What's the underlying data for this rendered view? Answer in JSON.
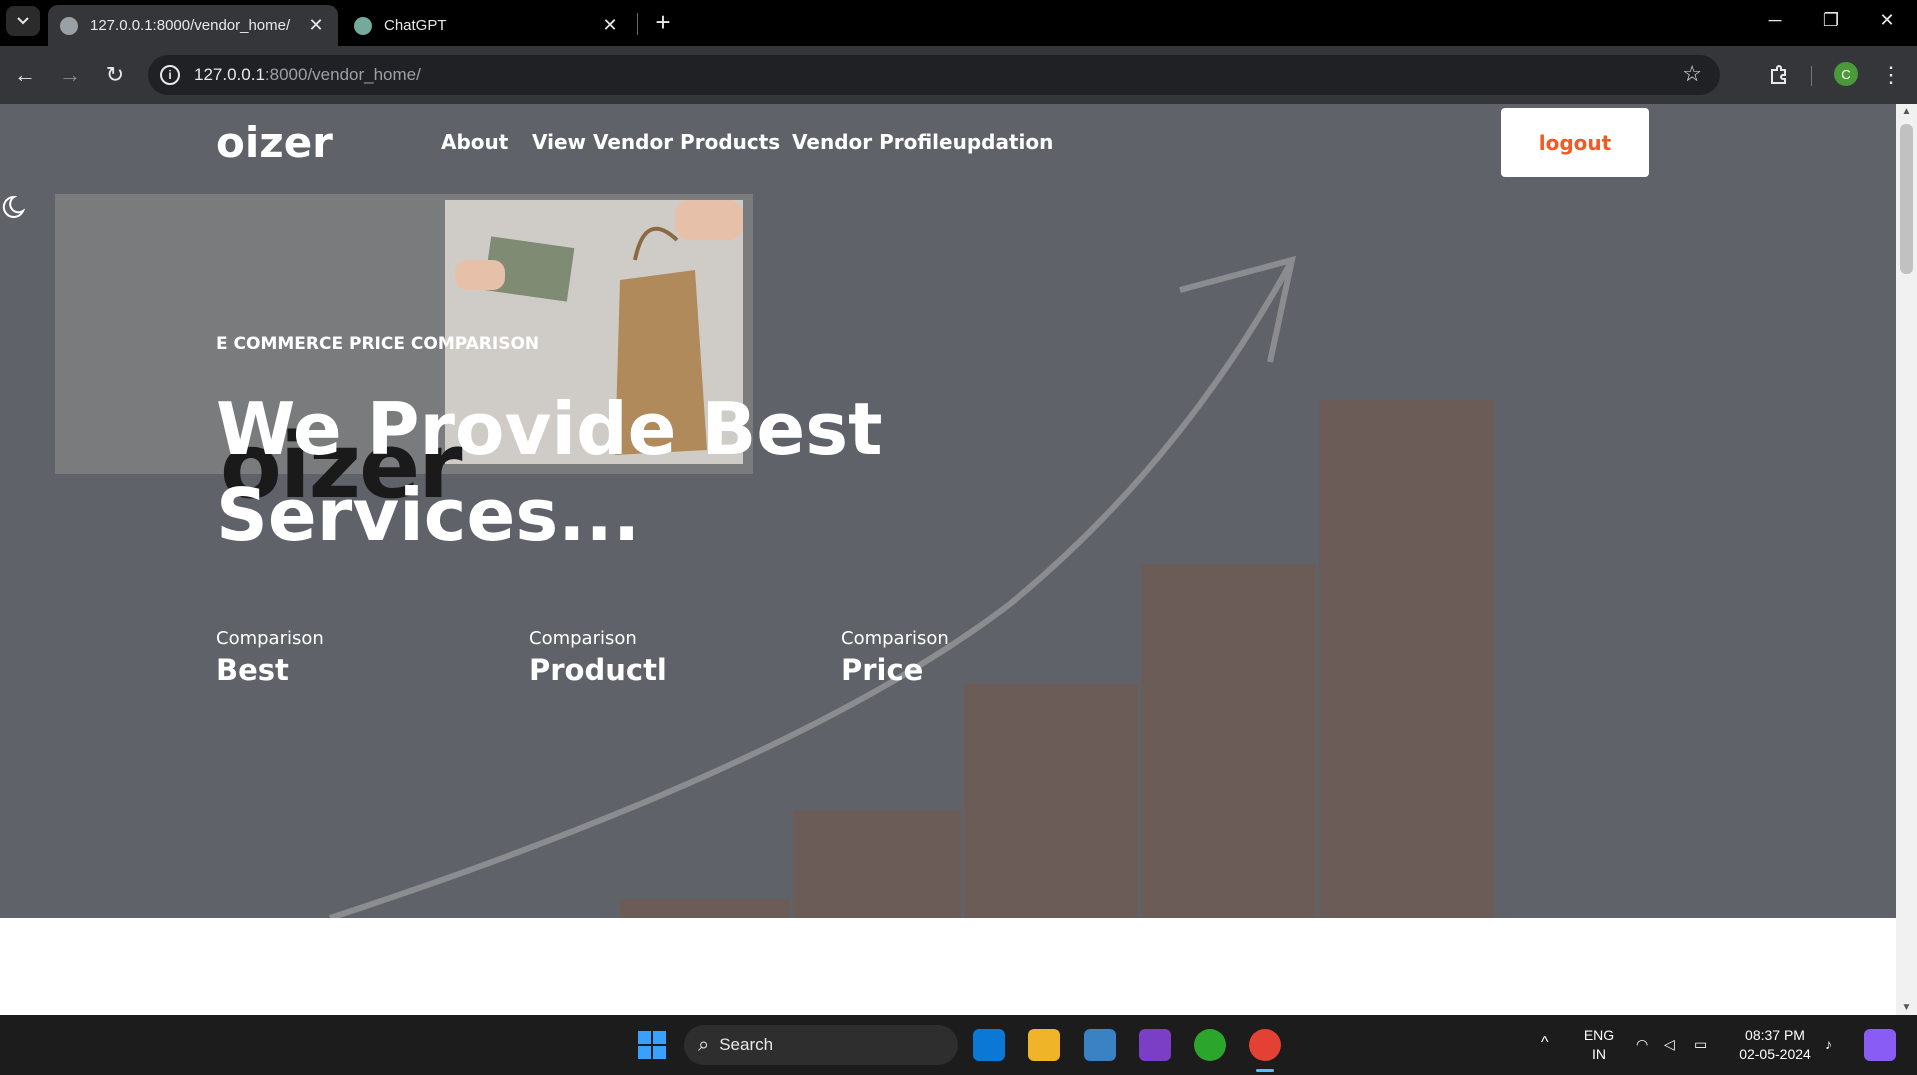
{
  "browser": {
    "tabs": [
      {
        "title": "127.0.0.1:8000/vendor_home/",
        "active": true
      },
      {
        "title": "ChatGPT",
        "active": false
      }
    ],
    "url_host": "127.0.0.1",
    "url_rest": ":8000/vendor_home/",
    "profile_initial": "C"
  },
  "nav": {
    "logo": "oizer",
    "links": [
      "About",
      "View Vendor Products",
      "Vendor Profileupdation"
    ],
    "logout_label": "logout"
  },
  "promo": {
    "logo_text": "oizer"
  },
  "hero": {
    "eyebrow": "E COMMERCE PRICE COMPARISON",
    "headline_line1": "We Provide Best",
    "headline_line2": "Services...",
    "stats": [
      {
        "sub": "Comparison",
        "value": "Best"
      },
      {
        "sub": "Comparison",
        "value": "Productl"
      },
      {
        "sub": "Comparison",
        "value": "Price"
      }
    ]
  },
  "taskbar": {
    "search_placeholder": "Search",
    "language": "ENG",
    "region": "IN",
    "time": "08:37 PM",
    "date": "02-05-2024"
  },
  "colors": {
    "accent": "#f15a22",
    "hero_overlay": "#5f6268",
    "block": "#6b5c57"
  }
}
